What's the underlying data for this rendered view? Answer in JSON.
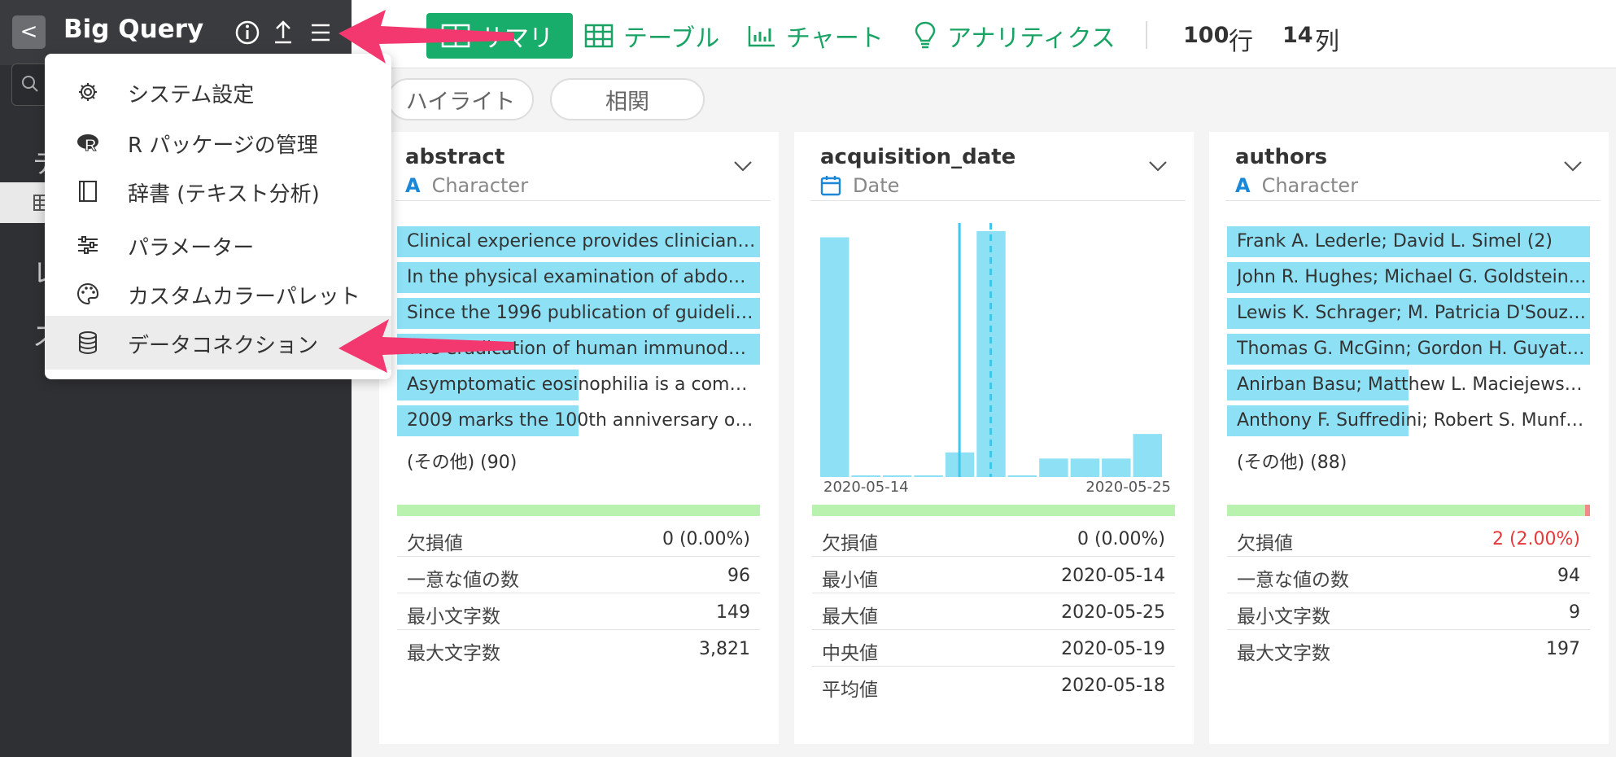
{
  "sidebar": {
    "back_label": "<",
    "title": "Big Query",
    "partial_items": [
      "テ",
      "レ",
      "ス"
    ]
  },
  "menu": {
    "items": [
      {
        "label": "システム設定",
        "icon": "gear-icon"
      },
      {
        "label": "R パッケージの管理",
        "icon": "r-logo-icon"
      },
      {
        "label": "辞書 (テキスト分析)",
        "icon": "book-icon"
      },
      {
        "label": "パラメーター",
        "icon": "sliders-icon"
      },
      {
        "label": "カスタムカラーパレット",
        "icon": "palette-icon"
      },
      {
        "label": "データコネクション",
        "icon": "database-icon"
      }
    ],
    "highlighted_index": 5
  },
  "toolbar": {
    "tabs": [
      {
        "label": "サマリ",
        "icon": "summary-icon",
        "active": true
      },
      {
        "label": "テーブル",
        "icon": "table-icon",
        "active": false
      },
      {
        "label": "チャート",
        "icon": "chart-icon",
        "active": false
      },
      {
        "label": "アナリティクス",
        "icon": "lightbulb-icon",
        "active": false
      }
    ],
    "rows_count": "100",
    "rows_unit": "行",
    "cols_count": "14",
    "cols_unit": "列"
  },
  "filters": {
    "highlight": "ハイライト",
    "correlation": "相関"
  },
  "colors": {
    "accent": "#19ad6b",
    "bar": "#8ee0f5",
    "quality_ok": "#b8f2ae",
    "missing": "#f08a8a",
    "arrow": "#f2386f"
  },
  "columns": [
    {
      "name": "abstract",
      "type": "Character",
      "bars": [
        {
          "text": "Clinical experience provides clinicians…",
          "fraction": 1.0
        },
        {
          "text": "In the physical examination of abdomi…",
          "fraction": 1.0
        },
        {
          "text": "Since the 1996 publication of guidelin…",
          "fraction": 1.0
        },
        {
          "text": "The eradication of human immunodefi…",
          "fraction": 1.0
        },
        {
          "text": "Asymptomatic eosinophilia is a comm…",
          "fraction": 0.5
        },
        {
          "text": "2009 marks the 100th anniversary of t…",
          "fraction": 0.5
        }
      ],
      "others": "(その他) (90)",
      "stats": [
        {
          "label": "欠損値",
          "value": "0 (0.00%)"
        },
        {
          "label": "一意な値の数",
          "value": "96"
        },
        {
          "label": "最小文字数",
          "value": "149"
        },
        {
          "label": "最大文字数",
          "value": "3,821"
        }
      ]
    },
    {
      "name": "acquisition_date",
      "type": "Date",
      "histogram": {
        "counts": [
          39,
          0,
          0,
          0,
          4,
          40,
          0,
          3,
          3,
          3,
          7
        ],
        "x_min_label": "2020-05-14",
        "x_max_label": "2020-05-25"
      },
      "stats": [
        {
          "label": "欠損値",
          "value": "0 (0.00%)"
        },
        {
          "label": "最小値",
          "value": "2020-05-14"
        },
        {
          "label": "最大値",
          "value": "2020-05-25"
        },
        {
          "label": "中央値",
          "value": "2020-05-19"
        },
        {
          "label": "平均値",
          "value": "2020-05-18"
        }
      ]
    },
    {
      "name": "authors",
      "type": "Character",
      "bars": [
        {
          "text": "Frank A. Lederle; David L. Simel (2)",
          "fraction": 1.0
        },
        {
          "text": "John R. Hughes; Michael G. Goldstein…",
          "fraction": 1.0
        },
        {
          "text": "Lewis K. Schrager; M. Patricia D'Souz…",
          "fraction": 1.0
        },
        {
          "text": "Thomas G. McGinn; Gordon H. Guyat…",
          "fraction": 1.0
        },
        {
          "text": "Anirban Basu; Matthew L. Maciejewsk…",
          "fraction": 0.5
        },
        {
          "text": "Anthony F. Suffredini; Robert S. Munf…",
          "fraction": 0.5
        }
      ],
      "others": "(その他) (88)",
      "missing_fraction": 0.02,
      "stats": [
        {
          "label": "欠損値",
          "value": "2 (2.00%)"
        },
        {
          "label": "一意な値の数",
          "value": "94"
        },
        {
          "label": "最小文字数",
          "value": "9"
        },
        {
          "label": "最大文字数",
          "value": "197"
        }
      ]
    }
  ]
}
